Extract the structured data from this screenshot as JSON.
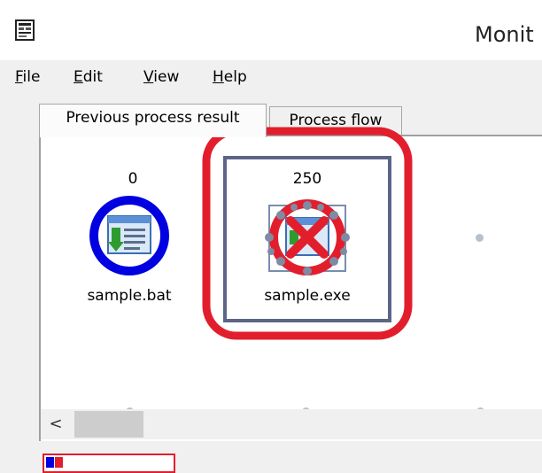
{
  "window": {
    "title": "Monit",
    "app_icon": "process-monitor-icon"
  },
  "menu": {
    "items": [
      {
        "label_ul": "F",
        "label_rest": "ile"
      },
      {
        "label_ul": "E",
        "label_rest": "dit"
      },
      {
        "label_ul": "V",
        "label_rest": "iew"
      },
      {
        "label_ul": "H",
        "label_rest": "elp"
      }
    ]
  },
  "tabs": [
    {
      "label": "Previous process result",
      "active": true
    },
    {
      "label": "Process flow",
      "active": false
    }
  ],
  "flow": {
    "nodes": [
      {
        "value": "0",
        "label": "sample.bat",
        "status": "ok",
        "icon": "batch-file-icon"
      },
      {
        "value": "250",
        "label": "sample.exe",
        "status": "error",
        "icon": "error-x-icon"
      }
    ]
  },
  "scrollbar": {
    "left_arrow": "<"
  },
  "colors": {
    "ok_ring": "#0000e0",
    "error": "#e21e2d",
    "selection_frame": "#5c6585"
  }
}
